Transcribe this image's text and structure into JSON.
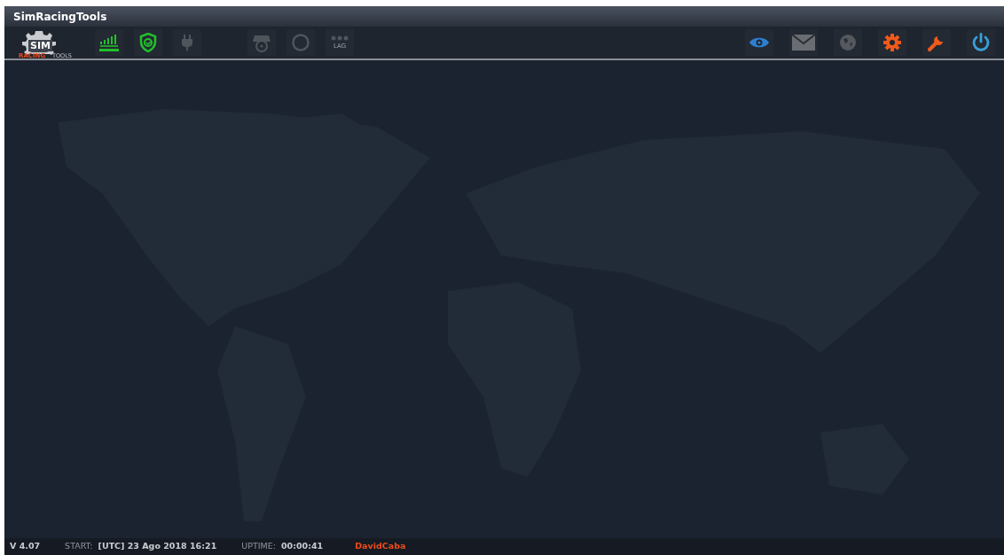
{
  "window": {
    "title": "SimRacingTools"
  },
  "logo": {
    "line_1": "SIM",
    "line_2": "RACING",
    "line_3": "TOOLS"
  },
  "toolbar_left": [
    {
      "kind": "signal",
      "active": true
    },
    {
      "kind": "shield",
      "active": true
    },
    {
      "kind": "plug",
      "active": false
    },
    {
      "kind": "gamepad",
      "active": false
    },
    {
      "kind": "ring",
      "active": false
    },
    {
      "kind": "lag",
      "label": "LAG",
      "active": false
    }
  ],
  "toolbar_right": [
    {
      "kind": "eye",
      "color": "#2f7fd1"
    },
    {
      "kind": "mail",
      "color": "#6a6d72"
    },
    {
      "kind": "globe",
      "color": "#55585d"
    },
    {
      "kind": "gear",
      "color": "#f05a1a"
    },
    {
      "kind": "wrench",
      "color": "#f05a1a"
    },
    {
      "kind": "power",
      "color": "#3aa0d8"
    }
  ],
  "status_bar": {
    "version": "V 4.07",
    "start_label": "START:",
    "start_value": "[UTC] 23 Ago 2018 16:21",
    "uptime_label": "UPTIME:",
    "uptime_value": "00:00:41",
    "user": "DavidCaba"
  }
}
